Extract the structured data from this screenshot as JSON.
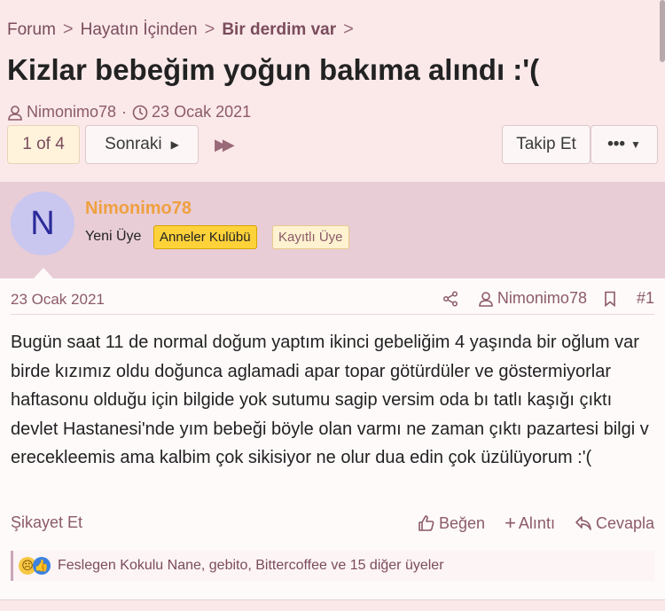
{
  "breadcrumb": {
    "items": [
      "Forum",
      "Hayatın İçinden",
      "Bir derdim var"
    ],
    "separator": ">"
  },
  "thread": {
    "title": "Kizlar bebeğim yoğun bakıma alındı :'(",
    "author": "Nimonimo78",
    "date": "23 Ocak 2021"
  },
  "pagination": {
    "current": "1 of 4",
    "next_label": "Sonraki"
  },
  "toolbar": {
    "follow_label": "Takip Et",
    "more_label": "•••"
  },
  "user": {
    "initial": "N",
    "name": "Nimonimo78",
    "role": "Yeni Üye",
    "badge1": "Anneler Kulübü",
    "badge2": "Kayıtlı Üye"
  },
  "post": {
    "date": "23 Ocak 2021",
    "author": "Nimonimo78",
    "number": "#1",
    "body": "Bugün saat 11 de normal doğum yaptım ikinci gebeliğim 4 yaşında bir oğlum var birde kızımız oldu doğunca aglamadi apar topar götürdüler ve göstermiyorlar haftasonu olduğu için bilgide yok sutumu sagip versim oda bı tatlı kaşığı çıktı devlet Hastanesi'nde yım bebeği böyle olan varmı ne zaman çıktı pazartesi bilgi v erecekleemis ama kalbim çok sikisiyor ne olur dua edin çok üzülüyorum :'(",
    "report_label": "Şikayet Et",
    "like_label": "Beğen",
    "quote_label": "Alıntı",
    "reply_label": "Cevapla",
    "reactions_text": "Feslegen Kokulu Nane, gebito, Bittercoffee ve 15 diğer üyeler"
  },
  "colors": {
    "accent": "#7a4c5c",
    "username": "#f0a040",
    "badge_gold": "#ffd23a"
  }
}
